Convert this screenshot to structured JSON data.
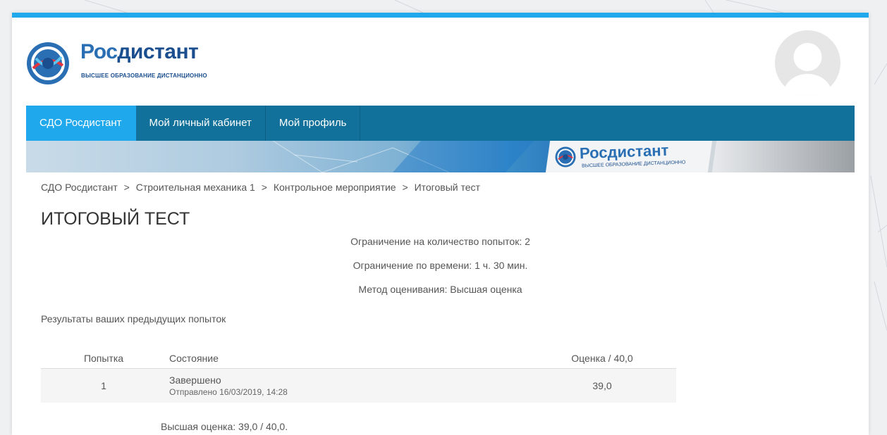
{
  "brand": {
    "name_part1": "Рос",
    "name_part2": "дистант",
    "tagline": "высшее образование дистанционно"
  },
  "nav": {
    "items": [
      {
        "label": "СДО Росдистант",
        "active": true
      },
      {
        "label": "Мой личный кабинет",
        "active": false
      },
      {
        "label": "Мой профиль",
        "active": false
      }
    ]
  },
  "banner": {
    "brand": "Росдистант",
    "tagline": "высшее образование дистанционно"
  },
  "breadcrumb": {
    "items": [
      "СДО Росдистант",
      "Строительная механика 1",
      "Контрольное мероприятие",
      "Итоговый тест"
    ],
    "separator": ">"
  },
  "page": {
    "title": "Итоговый тест",
    "info": [
      "Ограничение на количество попыток: 2",
      "Ограничение по времени: 1 ч. 30 мин.",
      "Метод оценивания: Высшая оценка"
    ],
    "results_label": "Результаты ваших предыдущих попыток"
  },
  "table": {
    "headers": {
      "attempt": "Попытка",
      "state": "Состояние",
      "grade": "Оценка / 40,0"
    },
    "rows": [
      {
        "attempt": "1",
        "state": "Завершено",
        "submitted": "Отправлено 16/03/2019, 14:28",
        "grade": "39,0"
      }
    ]
  },
  "best_grade": "Высшая оценка: 39,0 / 40,0.",
  "colors": {
    "accent": "#1fa8ec",
    "navbar": "#11719b",
    "brand_blue": "#2a6fb4"
  }
}
